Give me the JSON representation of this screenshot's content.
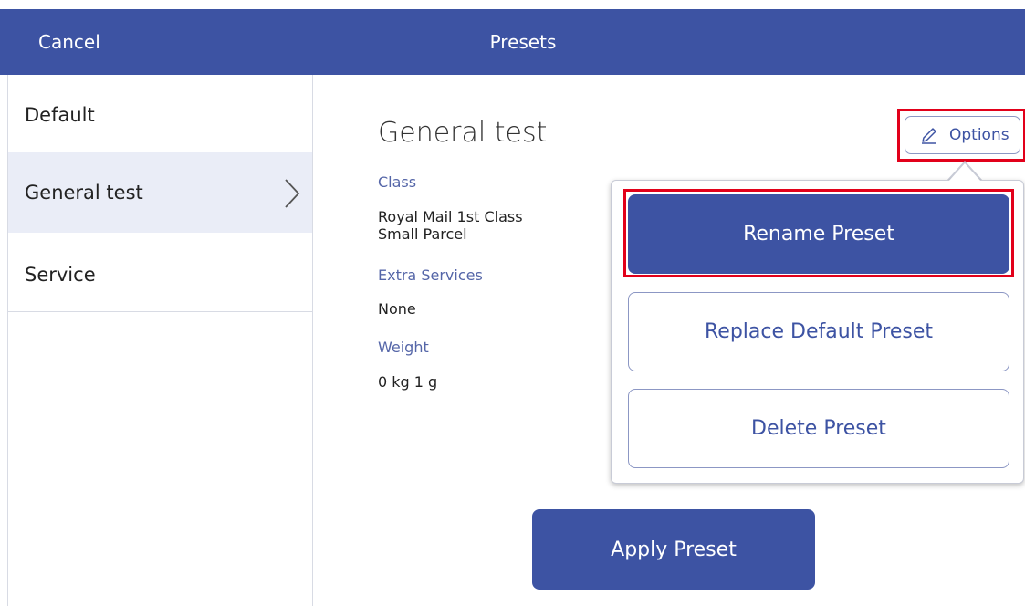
{
  "header": {
    "cancel_label": "Cancel",
    "title": "Presets"
  },
  "sidebar": {
    "items": [
      {
        "label": "Default",
        "selected": false
      },
      {
        "label": "General test",
        "selected": true
      },
      {
        "label": "Service",
        "selected": false
      }
    ]
  },
  "detail": {
    "title": "General test",
    "options_label": "Options",
    "fields": [
      {
        "label": "Class",
        "value_lines": [
          "Royal Mail 1st Class",
          "Small Parcel"
        ]
      },
      {
        "label": "Extra Services",
        "value_lines": [
          "None"
        ]
      },
      {
        "label": "Weight",
        "value_lines": [
          "0 kg 1 g"
        ]
      }
    ]
  },
  "options_menu": {
    "items": [
      {
        "label": "Rename Preset",
        "style": "primary"
      },
      {
        "label": "Replace Default Preset",
        "style": "outline"
      },
      {
        "label": "Delete Preset",
        "style": "outline"
      }
    ]
  },
  "apply_label": "Apply Preset",
  "colors": {
    "brand": "#3d53a3",
    "highlight": "#e2001a",
    "selected_row": "#eaedf7",
    "label_text": "#5566a8"
  },
  "icons": {
    "options": "pencil-icon",
    "sidebar_selected": "chevron-right-icon"
  }
}
